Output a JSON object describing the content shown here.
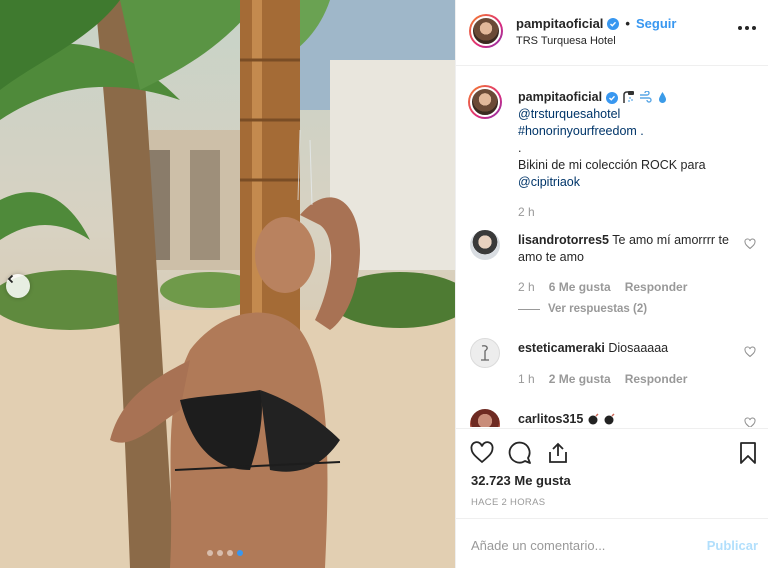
{
  "post": {
    "username": "pampitaoficial",
    "follow_label": "Seguir",
    "separator": "•",
    "location": "TRS Turquesa Hotel"
  },
  "caption": {
    "username": "pampitaoficial",
    "lines": [
      "@trsturquesahotel",
      "#honorinyourfreedom .",
      ".",
      "Bikini de mi colección ROCK para",
      "@cipitriaok"
    ],
    "time": "2 h"
  },
  "comments": [
    {
      "username": "lisandrotorres5",
      "text": "Te amo mí amorrrr te amo te amo",
      "time": "2 h",
      "likes": "6 Me gusta",
      "reply_label": "Responder",
      "view_replies": "Ver respuestas (2)"
    },
    {
      "username": "esteticameraki",
      "text": "Diosaaaaa",
      "time": "1 h",
      "likes": "2 Me gusta",
      "reply_label": "Responder"
    },
    {
      "username": "carlitos315",
      "text": ""
    }
  ],
  "stats": {
    "likes_count": "32.723",
    "likes_label": "Me gusta",
    "posted": "HACE 2 HORAS"
  },
  "comment_box": {
    "placeholder": "Añade un comentario...",
    "publish_label": "Publicar"
  },
  "colors": {
    "accent": "#3897f0",
    "publish_disabled": "#b2dffc",
    "text": "#262626",
    "muted": "#999999"
  },
  "carousel": {
    "slides": 4,
    "active_index": 3
  }
}
